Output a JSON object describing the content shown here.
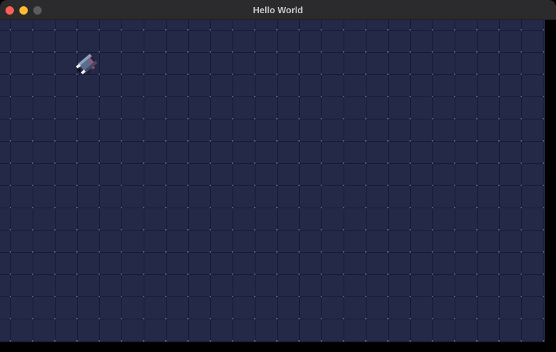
{
  "window": {
    "title": "Hello World"
  },
  "game": {
    "background_color": "#232946",
    "player_sprite": "robot-sprite"
  }
}
